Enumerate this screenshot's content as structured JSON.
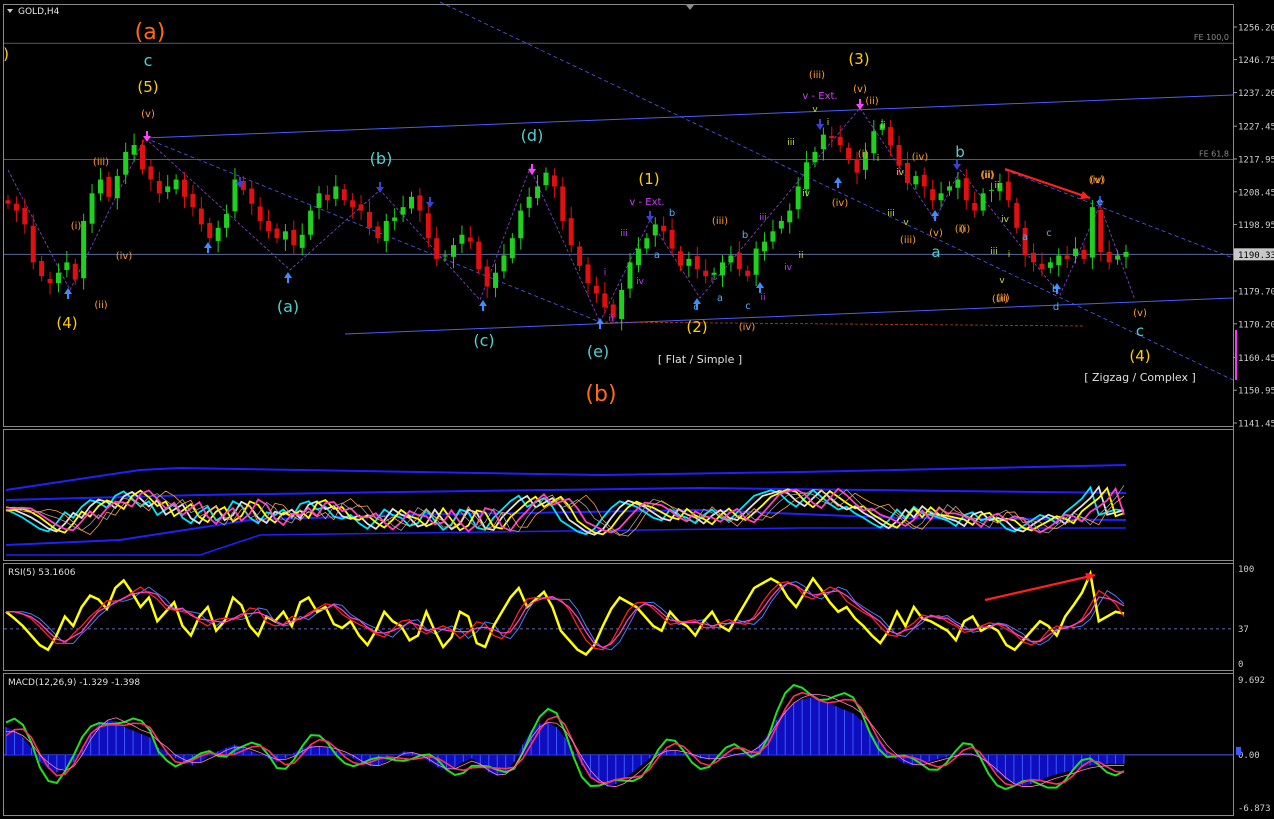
{
  "window": {
    "symbol_title": "GOLD,H4"
  },
  "colors": {
    "bull": "#1fd11f",
    "bear": "#e01010",
    "ma_cyan": "#00e5ff",
    "ma_yellow": "#ffff00",
    "ma_magenta": "#ff40c0",
    "channel": "#4a5cff",
    "orange": "#ff6a1a",
    "gold": "#ffd000",
    "teal": "#4fd0d0",
    "purple": "#c040ff",
    "rsi_blue": "#4a7cff",
    "macd_hist": "#1010e0"
  },
  "chart_data": [
    {
      "type": "candlestick",
      "panel": "main",
      "title": "GOLD,H4",
      "ylim": [
        1141.45,
        1260.0
      ],
      "y_ticks": [
        "1256.20",
        "1246.75",
        "1237.20",
        "1227.45",
        "1217.95",
        "1208.45",
        "1198.95",
        "1190.33",
        "1179.70",
        "1170.20",
        "1160.45",
        "1150.95",
        "1141.45"
      ],
      "last_price": "1190.33",
      "fib_levels": [
        {
          "label": "FE 100,0",
          "value": 1251.5
        },
        {
          "label": "FE 61,8",
          "value": 1217.8
        }
      ],
      "close_path": [
        1205,
        1203,
        1199,
        1188,
        1184,
        1182,
        1185,
        1188,
        1183,
        1200,
        1208,
        1212,
        1207,
        1213,
        1220,
        1222,
        1215,
        1212,
        1208,
        1210,
        1212,
        1207,
        1204,
        1199,
        1195,
        1198,
        1202,
        1212,
        1209,
        1205,
        1200,
        1197,
        1195,
        1197,
        1193,
        1196,
        1203,
        1208,
        1206,
        1210,
        1206,
        1204,
        1203,
        1198,
        1195,
        1200,
        1201,
        1204,
        1207,
        1203,
        1195,
        1189,
        1190,
        1193,
        1196,
        1194,
        1186,
        1181,
        1185,
        1190,
        1195,
        1203,
        1207,
        1210,
        1214,
        1210,
        1200,
        1193,
        1187,
        1182,
        1179,
        1175,
        1172,
        1180,
        1188,
        1192,
        1195,
        1199,
        1197,
        1192,
        1187,
        1189,
        1186,
        1184,
        1185,
        1188,
        1190,
        1186,
        1184,
        1192,
        1194,
        1197,
        1200,
        1203,
        1210,
        1217,
        1220,
        1225,
        1224,
        1222,
        1218,
        1214,
        1220,
        1226,
        1228,
        1222,
        1216,
        1211,
        1213,
        1210,
        1206,
        1208,
        1210,
        1212,
        1206,
        1203,
        1208,
        1209,
        1211,
        1206,
        1198,
        1190,
        1188,
        1186,
        1188,
        1190,
        1189,
        1192,
        1189,
        1204,
        1191,
        1188,
        1190,
        1191
      ],
      "wave_labels_orange": [
        "(a)",
        "(b)"
      ],
      "wave_labels_teal": [
        "c",
        "(d)",
        "(b)",
        "(a)",
        "(c)",
        "(e)",
        "b",
        "a",
        "c"
      ],
      "wave_labels_gold": [
        "(5)",
        "(4)",
        "(1)",
        "(2)",
        "(3)",
        "(4)"
      ],
      "wave_labels_small": [
        "(v)",
        "(iii)",
        "(i)",
        "(iv)",
        "(ii)",
        "(iii)",
        "(v)",
        "(ii)",
        "(i)",
        "(iv)",
        "(iii)",
        "(v)",
        "(i)",
        "(iv)",
        "(ii)",
        "(iii)",
        "(ii)",
        "(iv)",
        "(v)",
        "(i)",
        "(ii)",
        "(iii)",
        "(iv)",
        "(v)"
      ],
      "wave_labels_purple": [
        "v - Ext.",
        "v - Ext.",
        "iii",
        "iv",
        "i",
        "ii",
        "iii",
        "iv",
        "ii",
        "i"
      ],
      "annotations": [
        "[ Flat / Simple ]",
        "[ Zigzag / Complex ]"
      ]
    },
    {
      "type": "line",
      "panel": "moving-averages",
      "series_count": 6
    },
    {
      "type": "line",
      "panel": "rsi",
      "title": "RSI(5) 53.1606",
      "ylim": [
        0,
        100
      ],
      "y_ticks": [
        "100",
        "37",
        "0"
      ],
      "reference_level": 37,
      "values": [
        55,
        48,
        40,
        30,
        20,
        15,
        30,
        50,
        40,
        60,
        72,
        68,
        58,
        80,
        88,
        75,
        60,
        70,
        45,
        55,
        65,
        40,
        30,
        50,
        60,
        35,
        45,
        70,
        62,
        40,
        30,
        50,
        45,
        55,
        40,
        65,
        70,
        55,
        60,
        42,
        38,
        45,
        30,
        20,
        35,
        55,
        45,
        40,
        25,
        30,
        55,
        35,
        18,
        28,
        55,
        50,
        22,
        18,
        40,
        55,
        70,
        80,
        60,
        68,
        76,
        60,
        35,
        25,
        15,
        10,
        20,
        40,
        58,
        70,
        65,
        60,
        50,
        40,
        35,
        55,
        45,
        40,
        30,
        45,
        55,
        40,
        35,
        50,
        65,
        80,
        85,
        90,
        85,
        70,
        60,
        75,
        90,
        78,
        65,
        55,
        60,
        48,
        40,
        30,
        22,
        35,
        55,
        40,
        60,
        48,
        45,
        40,
        35,
        25,
        45,
        50,
        35,
        40,
        35,
        20,
        15,
        25,
        35,
        45,
        40,
        30,
        50,
        62,
        75,
        95,
        45,
        50,
        55,
        53
      ]
    },
    {
      "type": "bar",
      "panel": "macd",
      "title": "MACD(12,26,9) -1.329 -1.398",
      "ylim": [
        -6.873,
        9.692
      ],
      "y_ticks": [
        "9.692",
        "0.00",
        "-6.873"
      ],
      "values": [
        4,
        3.5,
        2.5,
        1,
        -1,
        -2,
        -2.5,
        -2,
        -1,
        1,
        3,
        4.5,
        5,
        4.8,
        4,
        3.5,
        3,
        2.5,
        1,
        0.5,
        -0.5,
        -1,
        -1.5,
        -1,
        0,
        0.5,
        1,
        1.5,
        1,
        0.5,
        0,
        -0.5,
        -1,
        -0.5,
        0.3,
        1,
        1.4,
        1.2,
        1,
        0.6,
        0.2,
        -0.5,
        -1.2,
        -1.6,
        -1.5,
        -0.8,
        0,
        0.5,
        0.4,
        -0.2,
        -1,
        -1.8,
        -2.2,
        -1.8,
        -1,
        -0.5,
        -1.5,
        -2.5,
        -3,
        -2.5,
        -1,
        1.5,
        3.5,
        4.5,
        4.6,
        4,
        2.5,
        0.5,
        -1.5,
        -3,
        -4,
        -4.5,
        -4.2,
        -3.5,
        -2.5,
        -1.5,
        -0.5,
        0.4,
        0.8,
        0.6,
        0.2,
        -0.2,
        -0.5,
        -0.7,
        -0.5,
        -0.2,
        0.2,
        0.3,
        0.5,
        1.5,
        3,
        5,
        6.5,
        7.5,
        8,
        8.2,
        8,
        7.6,
        7,
        6.5,
        6,
        5,
        3.5,
        2,
        0.5,
        -0.5,
        -1.2,
        -1.5,
        -1.3,
        -1,
        -0.6,
        -0.3,
        0,
        0.3,
        0.2,
        -0.5,
        -1.5,
        -2.5,
        -3.5,
        -4.2,
        -4.4,
        -4.2,
        -3.8,
        -3.2,
        -2.8,
        -2.5,
        -2.2,
        -1.8,
        -1.5,
        -1.4,
        -1.3,
        -1.3,
        -1.33
      ],
      "signal": [
        3,
        3,
        2.5,
        1.5,
        0,
        -1,
        -1.8,
        -2,
        -1.5,
        0,
        2,
        3.5,
        4.5,
        4.8,
        4.3,
        3.8,
        3.2,
        2.8,
        1.8,
        1,
        0,
        -0.6,
        -1,
        -1,
        -0.5,
        0,
        0.6,
        1,
        1,
        0.7,
        0.3,
        -0.2,
        -0.6,
        -0.6,
        -0.2,
        0.5,
        1,
        1.1,
        1,
        0.8,
        0.4,
        -0.1,
        -0.8,
        -1.3,
        -1.4,
        -1,
        -0.4,
        0.2,
        0.3,
        0,
        -0.6,
        -1.3,
        -1.8,
        -1.8,
        -1.3,
        -0.8,
        -1.2,
        -2,
        -2.6,
        -2.5,
        -1.6,
        0.2,
        2.2,
        3.6,
        4.2,
        4.1,
        3.2,
        1.6,
        -0.3,
        -2,
        -3.2,
        -4,
        -4.1,
        -3.7,
        -2.9,
        -2,
        -1,
        0,
        0.5,
        0.6,
        0.4,
        0.1,
        -0.3,
        -0.5,
        -0.5,
        -0.3,
        0,
        0.2,
        0.4,
        1.1,
        2.3,
        4,
        5.5,
        6.7,
        7.4,
        7.8,
        7.8,
        7.6,
        7.2,
        6.7,
        6.2,
        5.4,
        4.2,
        2.8,
        1.3,
        0.2,
        -0.7,
        -1.2,
        -1.3,
        -1.1,
        -0.8,
        -0.5,
        -0.2,
        0.1,
        0.1,
        -0.3,
        -1,
        -1.9,
        -2.9,
        -3.7,
        -4.1,
        -4.1,
        -3.9,
        -3.4,
        -3,
        -2.7,
        -2.4,
        -2,
        -1.7,
        -1.5,
        -1.4,
        -1.35,
        -1.4
      ]
    }
  ]
}
